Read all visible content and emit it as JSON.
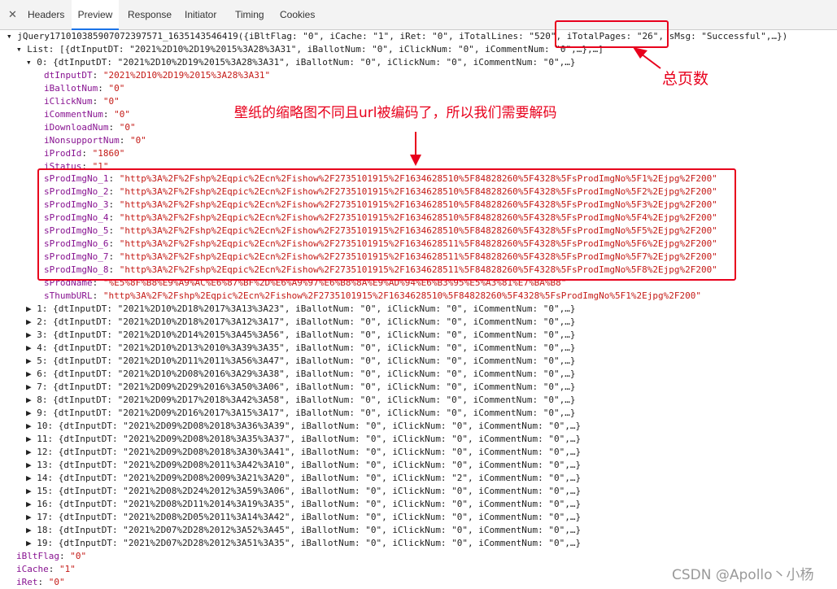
{
  "tabs": [
    "Headers",
    "Preview",
    "Response",
    "Initiator",
    "Timing",
    "Cookies"
  ],
  "root": "▾ jQuery171010385907072397571_1635143546419({iBltFlag: \"0\", iCache: \"1\", iRet: \"0\", iTotalLines: \"520\", iTotalPages: \"26\", sMsg: \"Successful\",…})",
  "list_head": "▾ List: [{dtInputDT: \"2021%2D10%2D19%2015%3A28%3A31\", iBallotNum: \"0\", iClickNum: \"0\", iCommentNum: \"0\",…},…]",
  "item0": "▾ 0: {dtInputDT: \"2021%2D10%2D19%2015%3A28%3A31\", iBallotNum: \"0\", iClickNum: \"0\", iCommentNum: \"0\",…}",
  "fields": [
    {
      "k": "dtInputDT",
      "v": "\"2021%2D10%2D19%2015%3A28%3A31\""
    },
    {
      "k": "iBallotNum",
      "v": "\"0\""
    },
    {
      "k": "iClickNum",
      "v": "\"0\""
    },
    {
      "k": "iCommentNum",
      "v": "\"0\""
    },
    {
      "k": "iDownloadNum",
      "v": "\"0\""
    },
    {
      "k": "iNonsupportNum",
      "v": "\"0\""
    },
    {
      "k": "iProdId",
      "v": "\"1860\""
    },
    {
      "k": "iStatus",
      "v": "\"1\""
    }
  ],
  "imgs": [
    {
      "k": "sProdImgNo_1",
      "v": "\"http%3A%2F%2Fshp%2Eqpic%2Ecn%2Fishow%2F2735101915%2F1634628510%5F84828260%5F4328%5FsProdImgNo%5F1%2Ejpg%2F200\""
    },
    {
      "k": "sProdImgNo_2",
      "v": "\"http%3A%2F%2Fshp%2Eqpic%2Ecn%2Fishow%2F2735101915%2F1634628510%5F84828260%5F4328%5FsProdImgNo%5F2%2Ejpg%2F200\""
    },
    {
      "k": "sProdImgNo_3",
      "v": "\"http%3A%2F%2Fshp%2Eqpic%2Ecn%2Fishow%2F2735101915%2F1634628510%5F84828260%5F4328%5FsProdImgNo%5F3%2Ejpg%2F200\""
    },
    {
      "k": "sProdImgNo_4",
      "v": "\"http%3A%2F%2Fshp%2Eqpic%2Ecn%2Fishow%2F2735101915%2F1634628510%5F84828260%5F4328%5FsProdImgNo%5F4%2Ejpg%2F200\""
    },
    {
      "k": "sProdImgNo_5",
      "v": "\"http%3A%2F%2Fshp%2Eqpic%2Ecn%2Fishow%2F2735101915%2F1634628510%5F84828260%5F4328%5FsProdImgNo%5F5%2Ejpg%2F200\""
    },
    {
      "k": "sProdImgNo_6",
      "v": "\"http%3A%2F%2Fshp%2Eqpic%2Ecn%2Fishow%2F2735101915%2F1634628511%5F84828260%5F4328%5FsProdImgNo%5F6%2Ejpg%2F200\""
    },
    {
      "k": "sProdImgNo_7",
      "v": "\"http%3A%2F%2Fshp%2Eqpic%2Ecn%2Fishow%2F2735101915%2F1634628511%5F84828260%5F4328%5FsProdImgNo%5F7%2Ejpg%2F200\""
    },
    {
      "k": "sProdImgNo_8",
      "v": "\"http%3A%2F%2Fshp%2Eqpic%2Ecn%2Fishow%2F2735101915%2F1634628511%5F84828260%5F4328%5FsProdImgNo%5F8%2Ejpg%2F200\""
    }
  ],
  "tail_fields": [
    {
      "k": "sProdName",
      "v": "\"%E5%8F%B8%E9%A9%AC%E6%87%BF%2D%E6%A9%97%E6%B8%8A%E9%AD%94%E6%B3%95%E5%A3%81%E7%BA%B8\""
    },
    {
      "k": "sThumbURL",
      "v": "\"http%3A%2F%2Fshp%2Eqpic%2Ecn%2Fishow%2F2735101915%2F1634628510%5F84828260%5F4328%5FsProdImgNo%5F1%2Ejpg%2F200\""
    }
  ],
  "items": [
    "▶ 1: {dtInputDT: \"2021%2D10%2D18%2017%3A13%3A23\", iBallotNum: \"0\", iClickNum: \"0\", iCommentNum: \"0\",…}",
    "▶ 2: {dtInputDT: \"2021%2D10%2D18%2017%3A12%3A17\", iBallotNum: \"0\", iClickNum: \"0\", iCommentNum: \"0\",…}",
    "▶ 3: {dtInputDT: \"2021%2D10%2D14%2015%3A45%3A56\", iBallotNum: \"0\", iClickNum: \"0\", iCommentNum: \"0\",…}",
    "▶ 4: {dtInputDT: \"2021%2D10%2D13%2010%3A39%3A35\", iBallotNum: \"0\", iClickNum: \"0\", iCommentNum: \"0\",…}",
    "▶ 5: {dtInputDT: \"2021%2D10%2D11%2011%3A56%3A47\", iBallotNum: \"0\", iClickNum: \"0\", iCommentNum: \"0\",…}",
    "▶ 6: {dtInputDT: \"2021%2D10%2D08%2016%3A29%3A38\", iBallotNum: \"0\", iClickNum: \"0\", iCommentNum: \"0\",…}",
    "▶ 7: {dtInputDT: \"2021%2D09%2D29%2016%3A50%3A06\", iBallotNum: \"0\", iClickNum: \"0\", iCommentNum: \"0\",…}",
    "▶ 8: {dtInputDT: \"2021%2D09%2D17%2018%3A42%3A58\", iBallotNum: \"0\", iClickNum: \"0\", iCommentNum: \"0\",…}",
    "▶ 9: {dtInputDT: \"2021%2D09%2D16%2017%3A15%3A17\", iBallotNum: \"0\", iClickNum: \"0\", iCommentNum: \"0\",…}",
    "▶ 10: {dtInputDT: \"2021%2D09%2D08%2018%3A36%3A39\", iBallotNum: \"0\", iClickNum: \"0\", iCommentNum: \"0\",…}",
    "▶ 11: {dtInputDT: \"2021%2D09%2D08%2018%3A35%3A37\", iBallotNum: \"0\", iClickNum: \"0\", iCommentNum: \"0\",…}",
    "▶ 12: {dtInputDT: \"2021%2D09%2D08%2018%3A30%3A41\", iBallotNum: \"0\", iClickNum: \"0\", iCommentNum: \"0\",…}",
    "▶ 13: {dtInputDT: \"2021%2D09%2D08%2011%3A42%3A10\", iBallotNum: \"0\", iClickNum: \"0\", iCommentNum: \"0\",…}",
    "▶ 14: {dtInputDT: \"2021%2D09%2D08%2009%3A21%3A20\", iBallotNum: \"0\", iClickNum: \"2\", iCommentNum: \"0\",…}",
    "▶ 15: {dtInputDT: \"2021%2D08%2D24%2012%3A59%3A06\", iBallotNum: \"0\", iClickNum: \"0\", iCommentNum: \"0\",…}",
    "▶ 16: {dtInputDT: \"2021%2D08%2D11%2014%3A19%3A35\", iBallotNum: \"0\", iClickNum: \"0\", iCommentNum: \"0\",…}",
    "▶ 17: {dtInputDT: \"2021%2D08%2D05%2011%3A14%3A42\", iBallotNum: \"0\", iClickNum: \"0\", iCommentNum: \"0\",…}",
    "▶ 18: {dtInputDT: \"2021%2D07%2D28%2012%3A52%3A45\", iBallotNum: \"0\", iClickNum: \"0\", iCommentNum: \"0\",…}",
    "▶ 19: {dtInputDT: \"2021%2D07%2D28%2012%3A51%3A35\", iBallotNum: \"0\", iClickNum: \"0\", iCommentNum: \"0\",…}"
  ],
  "footer_fields": [
    {
      "k": "iBltFlag",
      "v": "\"0\""
    },
    {
      "k": "iCache",
      "v": "\"1\""
    },
    {
      "k": "iRet",
      "v": "\"0\""
    }
  ],
  "annot_total_pages": "总页数",
  "annot_decode": "壁纸的缩略图不同且url被编码了，所以我们需要解码",
  "watermark": "CSDN @Apollo丶小杨"
}
